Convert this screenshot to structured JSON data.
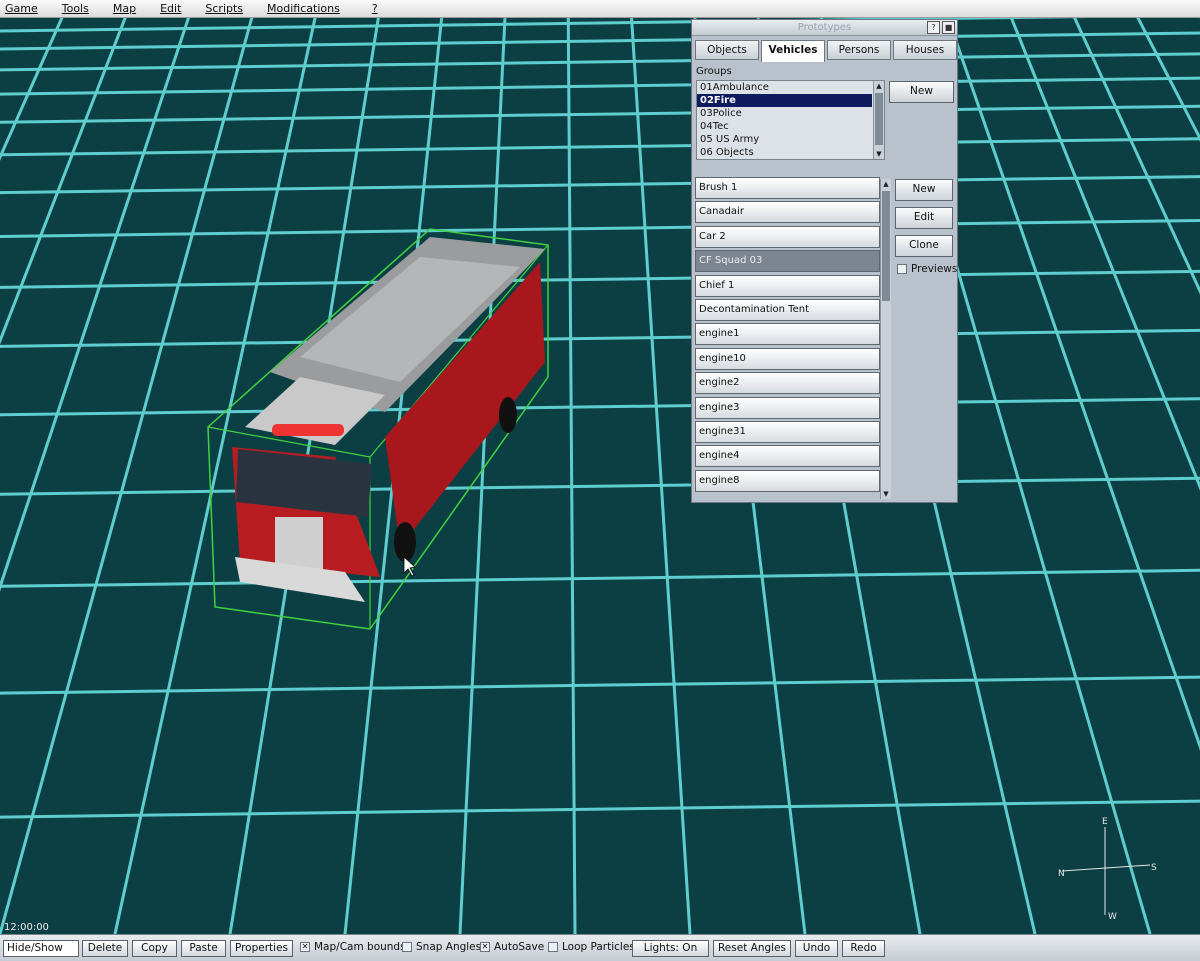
{
  "menubar": {
    "items": [
      "Game",
      "Tools",
      "Map",
      "Edit",
      "Scripts",
      "Modifications",
      "?"
    ]
  },
  "prototypes": {
    "title": "Prototypes",
    "help_label": "?",
    "tabs": [
      "Objects",
      "Vehicles",
      "Persons",
      "Houses"
    ],
    "active_tab": "Vehicles",
    "groups_label": "Groups",
    "groups": [
      "01Ambulance",
      "02Fire",
      "03Police",
      "04Tec",
      "05 US Army",
      "06 Objects"
    ],
    "selected_group": "02Fire",
    "group_new_label": "New",
    "vehicles": [
      "Brush 1",
      "Canadair",
      "Car 2",
      "CF Squad 03",
      "Chief 1",
      "Decontamination Tent",
      "engine1",
      "engine10",
      "engine2",
      "engine3",
      "engine31",
      "engine4",
      "engine8"
    ],
    "selected_vehicle": "CF Squad 03",
    "new_label": "New",
    "edit_label": "Edit",
    "clone_label": "Clone",
    "previews_label": "Previews",
    "previews_checked": false
  },
  "viewport": {
    "clock": "12:00:00",
    "compass": {
      "n": "N",
      "e": "E",
      "s": "S",
      "w": "W"
    },
    "grid_color": "#6ee6e6",
    "ground_color": "#0b3f44"
  },
  "toolbar": {
    "hide_show_value": "Hide/Show",
    "delete_label": "Delete",
    "copy_label": "Copy",
    "paste_label": "Paste",
    "properties_label": "Properties",
    "map_cam_bounds_label": "Map/Cam bounds",
    "map_cam_bounds_checked": true,
    "snap_angles_label": "Snap Angles",
    "snap_angles_checked": false,
    "autosave_label": "AutoSave",
    "autosave_checked": true,
    "loop_particles_label": "Loop Particles",
    "loop_particles_checked": false,
    "lights_label": "Lights: On",
    "reset_angles_label": "Reset Angles",
    "undo_label": "Undo",
    "redo_label": "Redo"
  }
}
